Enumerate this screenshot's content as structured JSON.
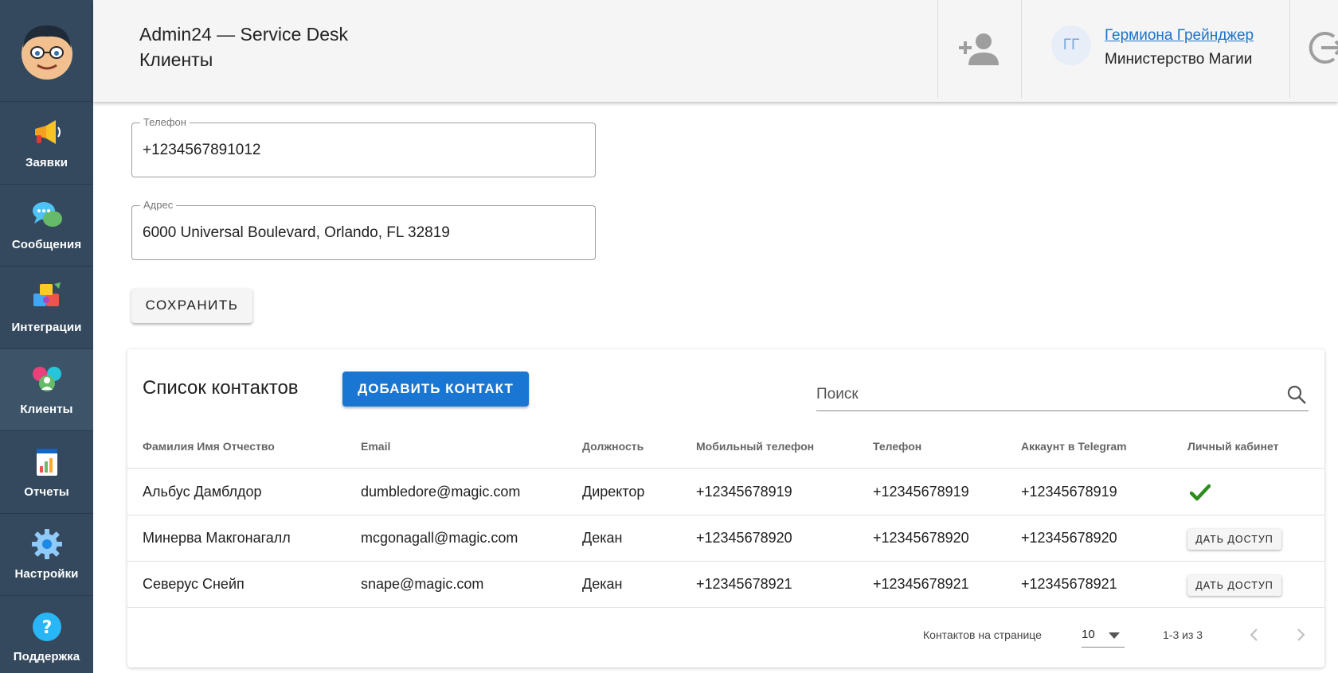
{
  "sidebar": {
    "logo_icon": "avatar-cartoon-icon",
    "items": [
      {
        "label": "Заявки",
        "icon": "megaphone-icon"
      },
      {
        "label": "Сообщения",
        "icon": "chat-bubbles-icon"
      },
      {
        "label": "Интеграции",
        "icon": "puzzle-icon"
      },
      {
        "label": "Клиенты",
        "icon": "clients-icon"
      },
      {
        "label": "Отчеты",
        "icon": "report-icon"
      },
      {
        "label": "Настройки",
        "icon": "gear-icon"
      },
      {
        "label": "Поддержка",
        "icon": "help-icon"
      }
    ]
  },
  "header": {
    "app_title": "Admin24 — Service Desk",
    "page_title": "Клиенты",
    "user": {
      "initials": "ГГ",
      "name": "Гермиона Грейнджер",
      "organization": "Министерство Магии"
    }
  },
  "form": {
    "phone_label": "Телефон",
    "phone_value": "+1234567891012",
    "address_label": "Адрес",
    "address_value": "6000 Universal Boulevard, Orlando, FL 32819",
    "save_label": "СОХРАНИТЬ"
  },
  "contacts": {
    "title": "Список контактов",
    "add_label": "ДОБАВИТЬ КОНТАКТ",
    "search_placeholder": "Поиск",
    "columns": [
      "Фамилия Имя Отчество",
      "Email",
      "Должность",
      "Мобильный телефон",
      "Телефон",
      "Аккаунт в Telegram",
      "Личный кабинет"
    ],
    "grant_label": "ДАТЬ ДОСТУП",
    "rows": [
      {
        "name": "Альбус Дамблдор",
        "email": "dumbledore@magic.com",
        "position": "Директор",
        "mobile": "+12345678919",
        "phone": "+12345678919",
        "telegram": "+12345678919",
        "cabinet": "granted"
      },
      {
        "name": "Минерва Макгонагалл",
        "email": "mcgonagall@magic.com",
        "position": "Декан",
        "mobile": "+12345678920",
        "phone": "+12345678920",
        "telegram": "+12345678920",
        "cabinet": "none"
      },
      {
        "name": "Северус Снейп",
        "email": "snape@magic.com",
        "position": "Декан",
        "mobile": "+12345678921",
        "phone": "+12345678921",
        "telegram": "+12345678921",
        "cabinet": "none"
      }
    ],
    "footer": {
      "rows_per_page_label": "Контактов на странице",
      "rows_per_page": "10",
      "range": "1-3 из 3"
    }
  },
  "colors": {
    "sidebar_bg": "#34495e",
    "primary": "#1976d2",
    "link": "#1e73c9",
    "check": "#2e8b1e"
  }
}
